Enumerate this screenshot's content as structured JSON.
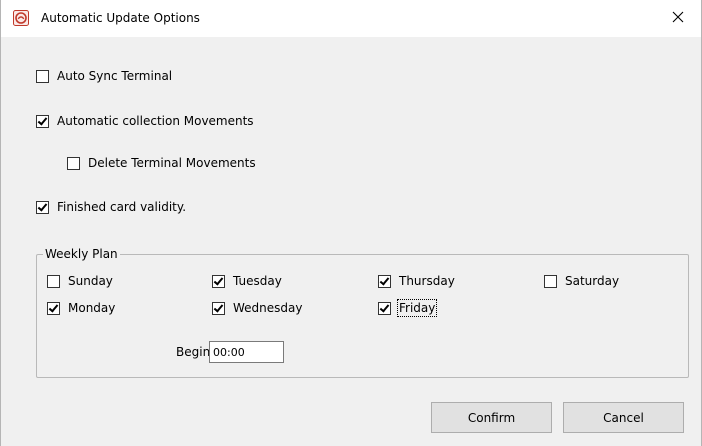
{
  "window": {
    "title": "Automatic Update Options",
    "icon": "app-logo-icon",
    "close_glyph": "✕",
    "accent": "#c0392b"
  },
  "options": {
    "auto_sync": {
      "label": "Auto Sync Terminal",
      "checked": false
    },
    "auto_collection": {
      "label": "Automatic collection Movements",
      "checked": true
    },
    "delete_terminal": {
      "label": "Delete Terminal Movements",
      "checked": false
    },
    "finished_card": {
      "label": "Finished card validity.",
      "checked": true
    }
  },
  "weekly_plan": {
    "legend": "Weekly Plan",
    "days": {
      "sunday": {
        "label": "Sunday",
        "checked": false
      },
      "monday": {
        "label": "Monday",
        "checked": true
      },
      "tuesday": {
        "label": "Tuesday",
        "checked": true
      },
      "wednesday": {
        "label": "Wednesday",
        "checked": true
      },
      "thursday": {
        "label": "Thursday",
        "checked": true
      },
      "friday": {
        "label": "Friday",
        "checked": true
      },
      "saturday": {
        "label": "Saturday",
        "checked": false
      }
    },
    "begin_label": "Begin:",
    "begin_value": "00:00"
  },
  "buttons": {
    "confirm": "Confirm",
    "cancel": "Cancel"
  }
}
